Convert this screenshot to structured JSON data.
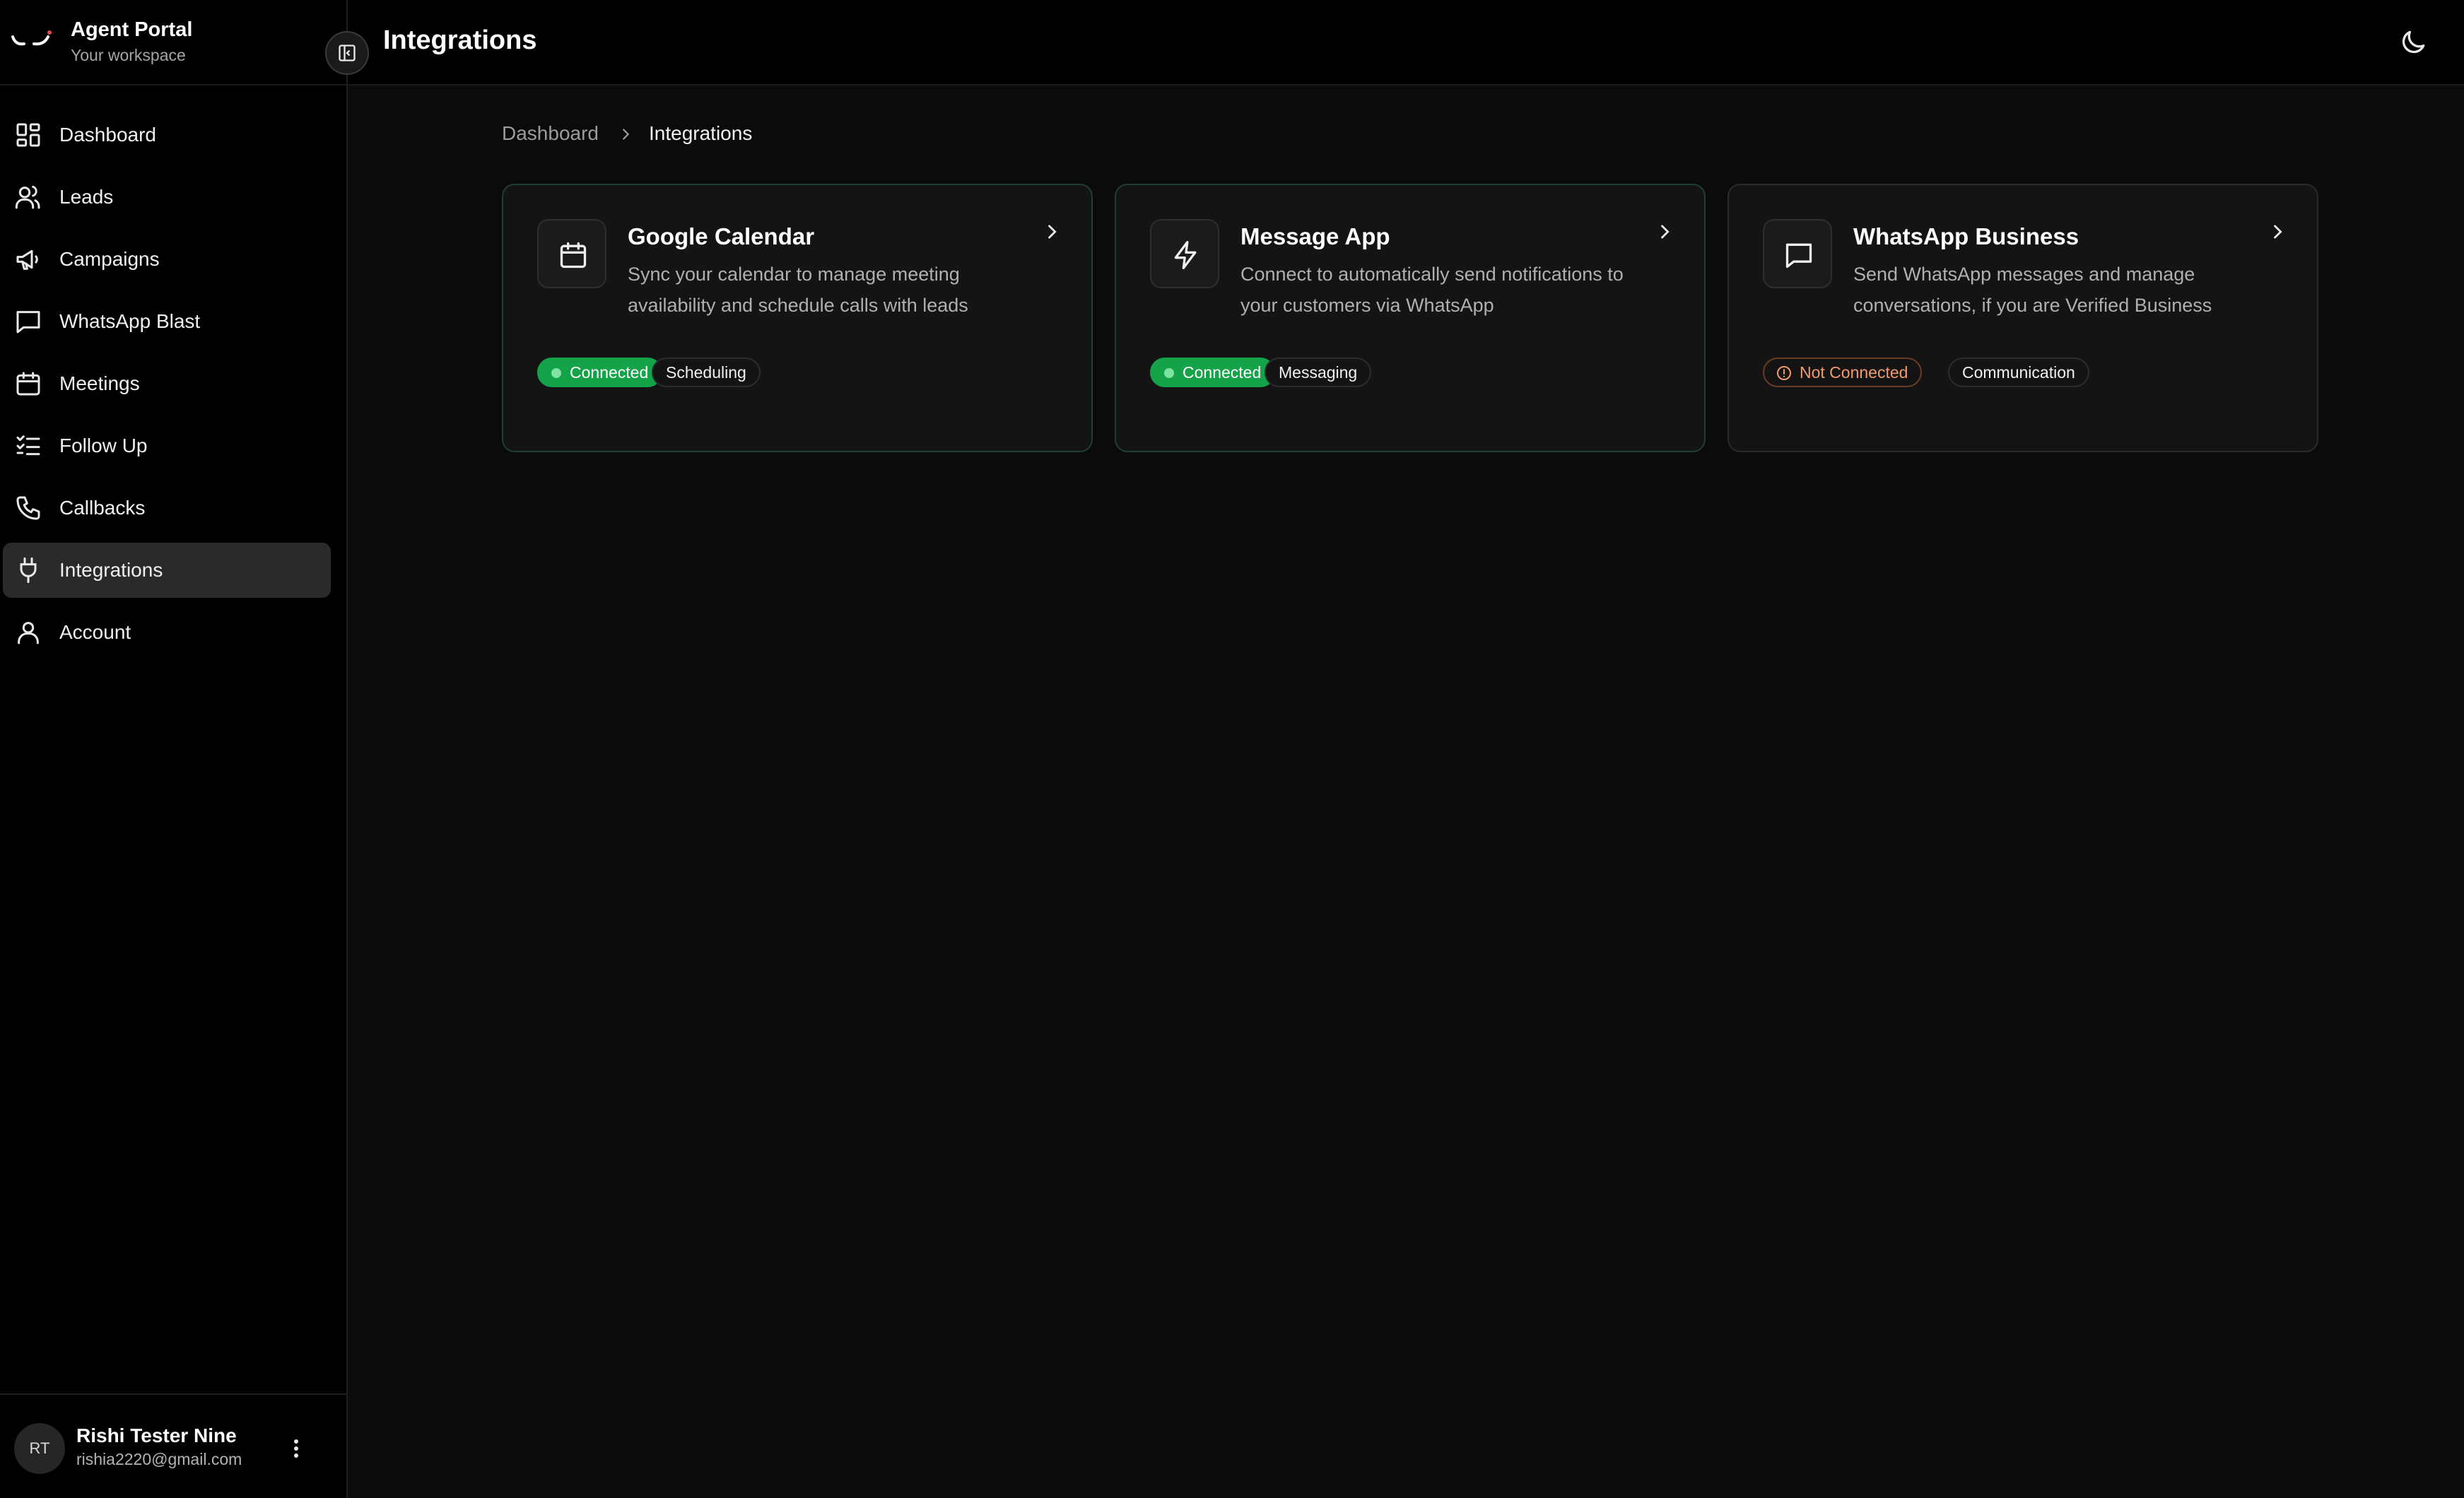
{
  "brand": {
    "title": "Agent Portal",
    "subtitle": "Your workspace"
  },
  "header": {
    "title": "Integrations"
  },
  "sidebar": {
    "items": [
      {
        "label": "Dashboard",
        "icon": "dashboard-icon"
      },
      {
        "label": "Leads",
        "icon": "users-icon"
      },
      {
        "label": "Campaigns",
        "icon": "megaphone-icon"
      },
      {
        "label": "WhatsApp Blast",
        "icon": "message-square-icon"
      },
      {
        "label": "Meetings",
        "icon": "calendar-icon"
      },
      {
        "label": "Follow Up",
        "icon": "list-checks-icon"
      },
      {
        "label": "Callbacks",
        "icon": "phone-icon"
      },
      {
        "label": "Integrations",
        "icon": "plug-icon",
        "active": true
      },
      {
        "label": "Account",
        "icon": "user-icon"
      }
    ]
  },
  "user": {
    "initials": "RT",
    "name": "Rishi Tester Nine",
    "email": "rishia2220@gmail.com"
  },
  "breadcrumb": {
    "home": "Dashboard",
    "current": "Integrations"
  },
  "integrations": [
    {
      "title": "Google Calendar",
      "description": "Sync your calendar to manage meeting availability and schedule calls with leads",
      "status": "Connected",
      "tag": "Scheduling",
      "icon": "calendar-icon"
    },
    {
      "title": "Message App",
      "description": "Connect to automatically send notifications to your customers via WhatsApp",
      "status": "Connected",
      "tag": "Messaging",
      "icon": "zap-icon"
    },
    {
      "title": "WhatsApp Business",
      "description": "Send WhatsApp messages and manage conversations, if you are Verified Business",
      "status": "Not Connected",
      "tag": "Communication",
      "icon": "message-square-icon"
    }
  ],
  "colors": {
    "connected": "#15a34a",
    "not_connected": "#f19a6b",
    "active_nav": "#2a2a2a"
  }
}
